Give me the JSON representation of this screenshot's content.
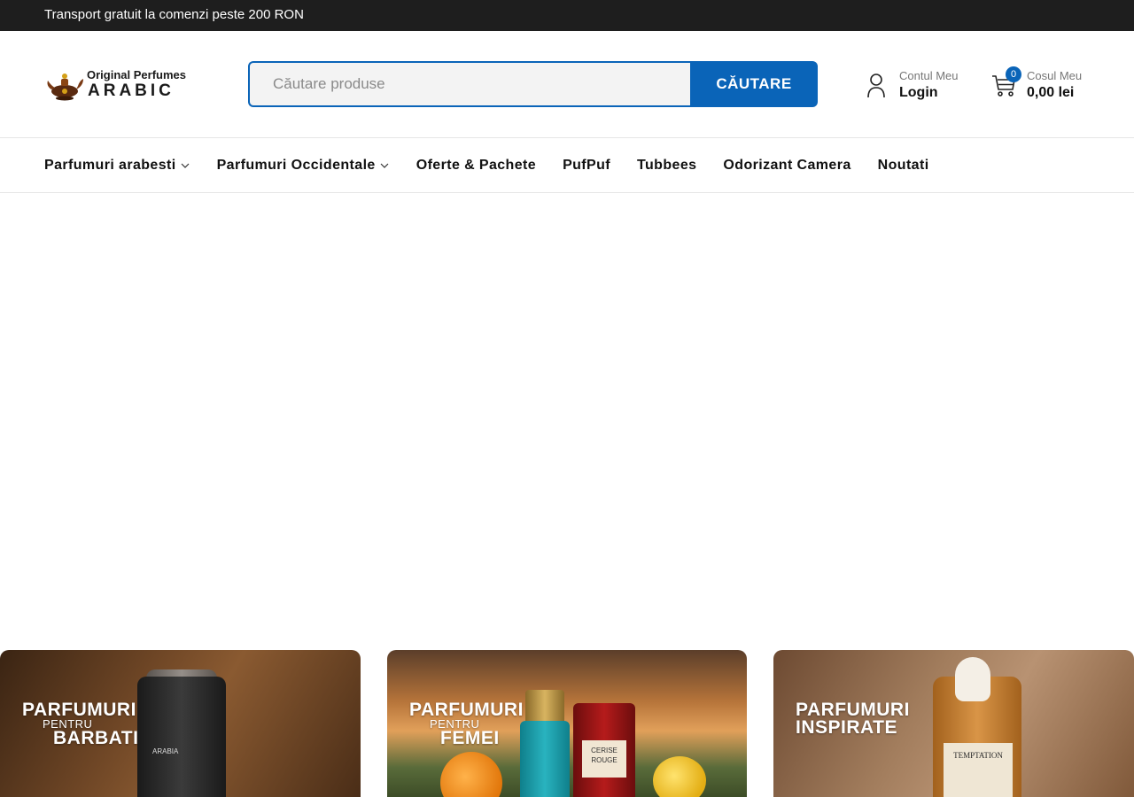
{
  "topbar": {
    "text": "Transport gratuit la comenzi peste 200 RON"
  },
  "logo": {
    "line1": "Original Perfumes",
    "line2": "ARABIC",
    "icon": "genie-lamp-icon"
  },
  "search": {
    "placeholder": "Căutare produse",
    "value": "",
    "button_label": "CĂUTARE"
  },
  "account": {
    "small_label": "Contul Meu",
    "big_label": "Login",
    "icon": "user-icon"
  },
  "cart": {
    "small_label": "Cosul Meu",
    "total": "0,00 lei",
    "count": "0",
    "icon": "cart-icon"
  },
  "nav": {
    "items": [
      {
        "label": "Parfumuri arabesti",
        "has_dropdown": true
      },
      {
        "label": "Parfumuri Occidentale",
        "has_dropdown": true
      },
      {
        "label": "Oferte & Pachete",
        "has_dropdown": false
      },
      {
        "label": "PufPuf",
        "has_dropdown": false
      },
      {
        "label": "Tubbees",
        "has_dropdown": false
      },
      {
        "label": "Odorizant Camera",
        "has_dropdown": false
      },
      {
        "label": "Noutati",
        "has_dropdown": false
      }
    ]
  },
  "banners": [
    {
      "title": "PARFUMURI",
      "sub": "PENTRU",
      "sub2": "BARBATI",
      "bottle_text": "ARABIA"
    },
    {
      "title": "PARFUMURI",
      "sub": "PENTRU",
      "sub2": "FEMEI",
      "bottle_text": "CERISE ROUGE"
    },
    {
      "title": "PARFUMURI",
      "sub2": "INSPIRATE",
      "bottle_text": "TEMPTATION"
    }
  ],
  "colors": {
    "accent": "#0a64b8",
    "topbar_bg": "#1e1e1e"
  }
}
